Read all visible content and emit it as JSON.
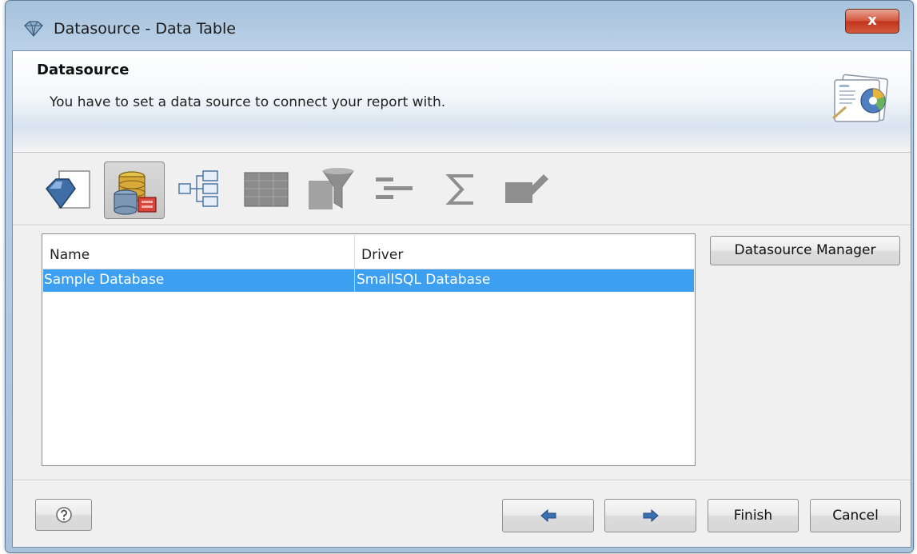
{
  "window": {
    "title": "Datasource - Data Table",
    "close_label": "x"
  },
  "header": {
    "title": "Datasource",
    "description": "You have to set a data source to connect your report with."
  },
  "steps": [
    {
      "name": "diamond-step-icon",
      "active": false
    },
    {
      "name": "database-step-icon",
      "active": true
    },
    {
      "name": "tree-step-icon",
      "active": false
    },
    {
      "name": "table-step-icon",
      "active": false
    },
    {
      "name": "filter-step-icon",
      "active": false
    },
    {
      "name": "align-step-icon",
      "active": false
    },
    {
      "name": "sigma-step-icon",
      "active": false
    },
    {
      "name": "edit-step-icon",
      "active": false
    }
  ],
  "table": {
    "columns": [
      "Name",
      "Driver"
    ],
    "rows": [
      {
        "name": "Sample Database",
        "driver": "SmallSQL Database",
        "selected": true
      }
    ]
  },
  "buttons": {
    "datasource_manager": "Datasource Manager",
    "finish": "Finish",
    "cancel": "Cancel"
  },
  "colors": {
    "selection": "#3d9ff0",
    "close_button": "#c8391f"
  }
}
